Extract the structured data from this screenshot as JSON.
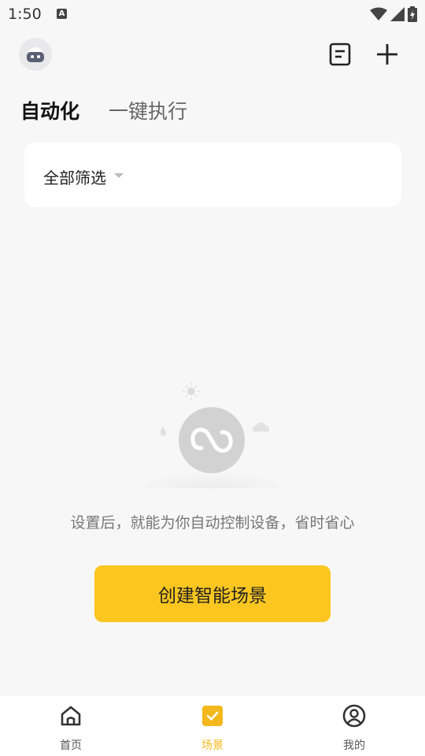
{
  "status_bar": {
    "time": "1:50",
    "a_badge": "A"
  },
  "header": {
    "avatar_icon": "robot-avatar-icon",
    "doc_icon": "document-icon",
    "add_icon": "plus-icon"
  },
  "tabs": [
    {
      "label": "自动化",
      "active": true
    },
    {
      "label": "一键执行",
      "active": false
    }
  ],
  "filter": {
    "label": "全部筛选"
  },
  "empty_state": {
    "message": "设置后，就能为你自动控制设备，省时省心",
    "button_label": "创建智能场景"
  },
  "bottom_nav": [
    {
      "label": "首页",
      "icon": "home-icon",
      "active": false
    },
    {
      "label": "场景",
      "icon": "scene-check-icon",
      "active": true
    },
    {
      "label": "我的",
      "icon": "profile-icon",
      "active": false
    }
  ],
  "colors": {
    "accent": "#fbc620",
    "nav_active": "#f3b81b",
    "background": "#f7f7f7"
  }
}
